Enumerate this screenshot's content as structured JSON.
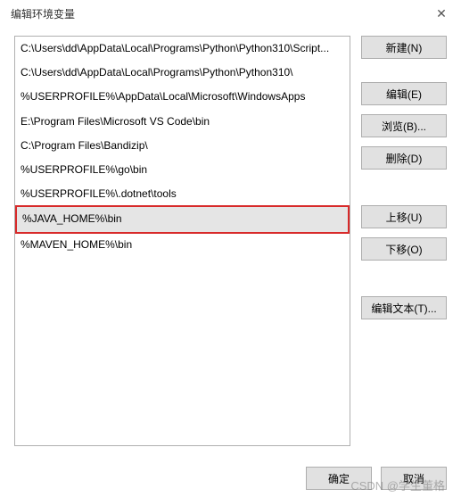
{
  "window": {
    "title": "编辑环境变量"
  },
  "list": {
    "items": [
      {
        "text": "C:\\Users\\dd\\AppData\\Local\\Programs\\Python\\Python310\\Script...",
        "selected": false,
        "highlighted": false
      },
      {
        "text": "C:\\Users\\dd\\AppData\\Local\\Programs\\Python\\Python310\\",
        "selected": false,
        "highlighted": false
      },
      {
        "text": "%USERPROFILE%\\AppData\\Local\\Microsoft\\WindowsApps",
        "selected": false,
        "highlighted": false
      },
      {
        "text": "E:\\Program Files\\Microsoft VS Code\\bin",
        "selected": false,
        "highlighted": false
      },
      {
        "text": "C:\\Program Files\\Bandizip\\",
        "selected": false,
        "highlighted": false
      },
      {
        "text": "%USERPROFILE%\\go\\bin",
        "selected": false,
        "highlighted": false
      },
      {
        "text": "%USERPROFILE%\\.dotnet\\tools",
        "selected": false,
        "highlighted": false
      },
      {
        "text": "%JAVA_HOME%\\bin",
        "selected": true,
        "highlighted": true
      },
      {
        "text": "%MAVEN_HOME%\\bin",
        "selected": false,
        "highlighted": false
      }
    ]
  },
  "buttons": {
    "new": "新建(N)",
    "edit": "编辑(E)",
    "browse": "浏览(B)...",
    "delete": "删除(D)",
    "move_up": "上移(U)",
    "move_down": "下移(O)",
    "edit_text": "编辑文本(T)..."
  },
  "footer": {
    "ok": "确定",
    "cancel": "取消"
  },
  "watermark": "CSDN @学生董格"
}
